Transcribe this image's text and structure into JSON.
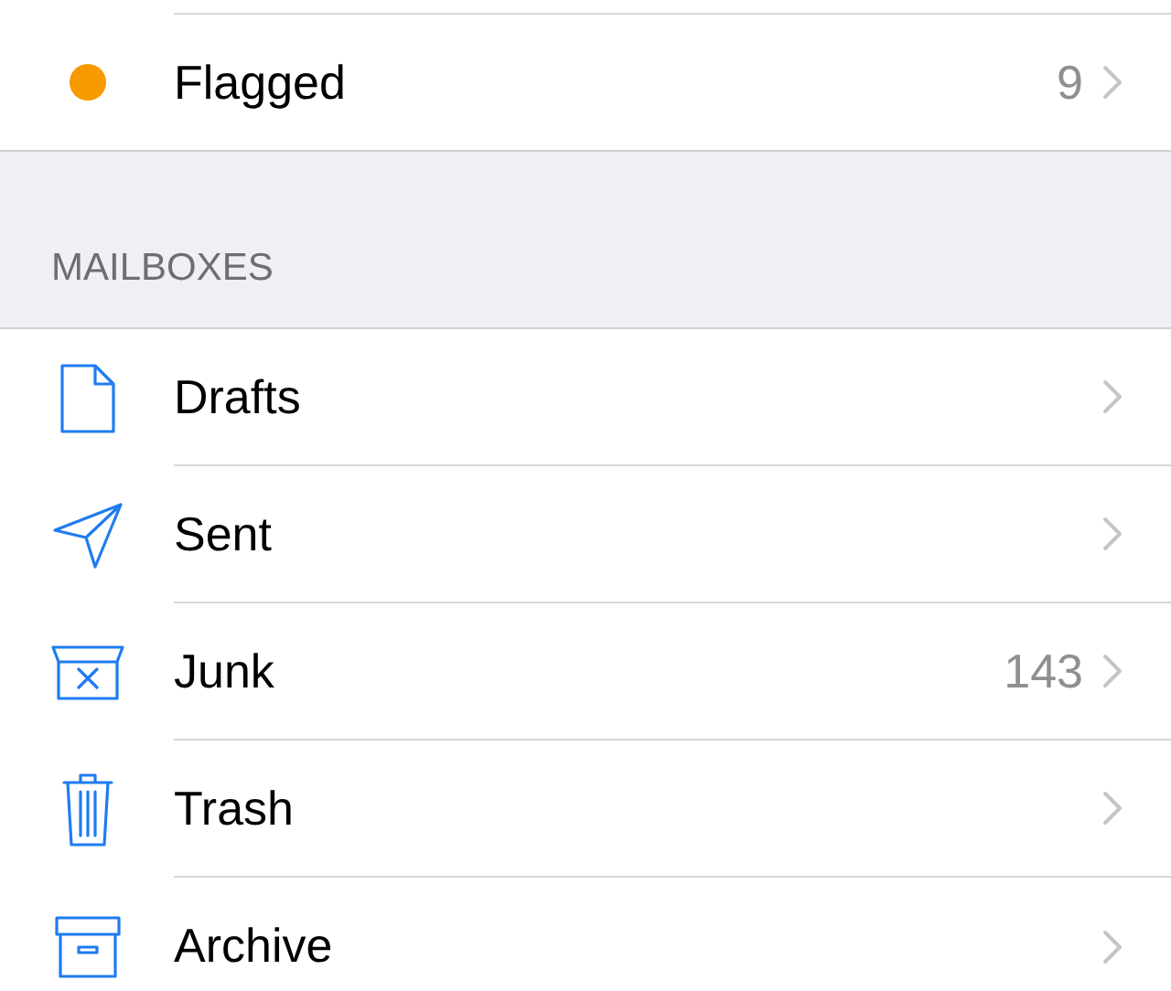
{
  "top_items": [
    {
      "label": "Flagged",
      "count": "9",
      "color": "#f79a00"
    }
  ],
  "section": {
    "title": "MAILBOXES"
  },
  "mailboxes": [
    {
      "kind": "drafts",
      "label": "Drafts"
    },
    {
      "kind": "sent",
      "label": "Sent"
    },
    {
      "kind": "junk",
      "label": "Junk",
      "count": "143"
    },
    {
      "kind": "trash",
      "label": "Trash"
    },
    {
      "kind": "archive",
      "label": "Archive"
    }
  ]
}
